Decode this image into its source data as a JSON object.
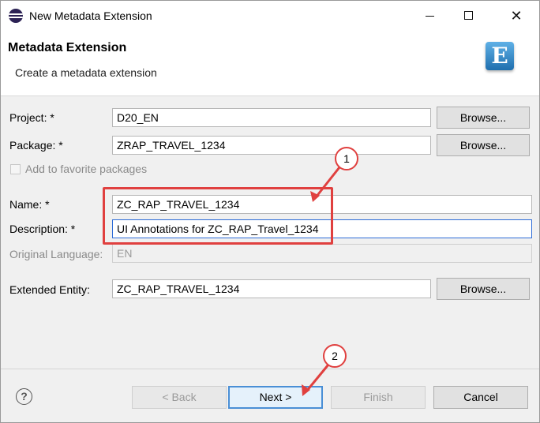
{
  "window": {
    "title": "New Metadata Extension"
  },
  "header": {
    "title": "Metadata Extension",
    "description": "Create a metadata extension",
    "logo_letter": "E"
  },
  "form": {
    "project": {
      "label": "Project: *",
      "value": "D20_EN"
    },
    "package": {
      "label": "Package: *",
      "value": "ZRAP_TRAVEL_1234"
    },
    "favorite": {
      "label": "Add to favorite packages",
      "checked": false
    },
    "name": {
      "label": "Name: *",
      "value": "ZC_RAP_TRAVEL_1234"
    },
    "description": {
      "label": "Description: *",
      "value": "UI Annotations for ZC_RAP_Travel_1234"
    },
    "original_language": {
      "label": "Original Language:",
      "value": "EN"
    },
    "extended_entity": {
      "label": "Extended Entity:",
      "value": "ZC_RAP_TRAVEL_1234"
    },
    "browse_label": "Browse..."
  },
  "annotations": {
    "badge1": "1",
    "badge2": "2",
    "color": "#e0403f"
  },
  "footer": {
    "help": "?",
    "back": "< Back",
    "next": "Next >",
    "finish": "Finish",
    "cancel": "Cancel"
  }
}
